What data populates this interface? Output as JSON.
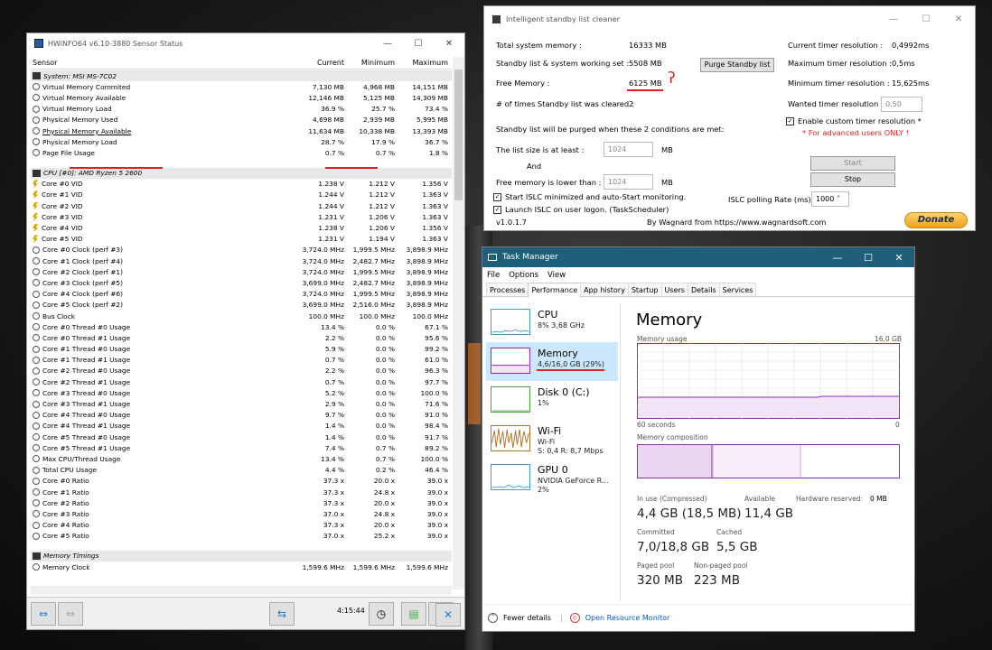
{
  "hwinfo": {
    "title": "HWiNFO64 v6.10-3880 Sensor Status",
    "columns": [
      "Sensor",
      "Current",
      "Minimum",
      "Maximum"
    ],
    "rows": [
      {
        "t": "grp",
        "n": "System: MSI MS-7C02",
        "i": "pc"
      },
      {
        "n": "Virtual Memory Commited",
        "c": "7,130 MB",
        "mi": "4,968 MB",
        "ma": "14,151 MB",
        "i": "round"
      },
      {
        "n": "Virtual Memory Available",
        "c": "12,146 MB",
        "mi": "5,125 MB",
        "ma": "14,309 MB",
        "i": "round"
      },
      {
        "n": "Virtual Memory Load",
        "c": "36.9 %",
        "mi": "25.7 %",
        "ma": "73.4 %",
        "i": "round"
      },
      {
        "n": "Physical Memory Used",
        "c": "4,698 MB",
        "mi": "2,939 MB",
        "ma": "5,995 MB",
        "i": "round"
      },
      {
        "n": "Physical Memory Available",
        "c": "11,634 MB",
        "mi": "10,338 MB",
        "ma": "13,393 MB",
        "i": "round",
        "hl": true
      },
      {
        "n": "Physical Memory Load",
        "c": "28.7 %",
        "mi": "17.9 %",
        "ma": "36.7 %",
        "i": "round"
      },
      {
        "n": "Page File Usage",
        "c": "0.7 %",
        "mi": "0.7 %",
        "ma": "1.8 %",
        "i": "round"
      },
      {
        "t": "gap"
      },
      {
        "t": "grp",
        "n": "CPU [#0]: AMD Ryzen 5 2600",
        "i": "chip"
      },
      {
        "n": "Core #0 VID",
        "c": "1.238 V",
        "mi": "1.212 V",
        "ma": "1.356 V",
        "i": "volt"
      },
      {
        "n": "Core #1 VID",
        "c": "1.244 V",
        "mi": "1.212 V",
        "ma": "1.363 V",
        "i": "volt"
      },
      {
        "n": "Core #2 VID",
        "c": "1.244 V",
        "mi": "1.212 V",
        "ma": "1.363 V",
        "i": "volt"
      },
      {
        "n": "Core #3 VID",
        "c": "1.231 V",
        "mi": "1.206 V",
        "ma": "1.363 V",
        "i": "volt"
      },
      {
        "n": "Core #4 VID",
        "c": "1.238 V",
        "mi": "1.206 V",
        "ma": "1.356 V",
        "i": "volt"
      },
      {
        "n": "Core #5 VID",
        "c": "1.231 V",
        "mi": "1.194 V",
        "ma": "1.363 V",
        "i": "volt"
      },
      {
        "n": "Core #0 Clock (perf #3)",
        "c": "3,724.0 MHz",
        "mi": "1,999.5 MHz",
        "ma": "3,898.9 MHz",
        "i": "round"
      },
      {
        "n": "Core #1 Clock (perf #4)",
        "c": "3,724.0 MHz",
        "mi": "2,482.7 MHz",
        "ma": "3,898.9 MHz",
        "i": "round"
      },
      {
        "n": "Core #2 Clock (perf #1)",
        "c": "3,724.0 MHz",
        "mi": "1,999.5 MHz",
        "ma": "3,898.9 MHz",
        "i": "round"
      },
      {
        "n": "Core #3 Clock (perf #5)",
        "c": "3,699.0 MHz",
        "mi": "2,482.7 MHz",
        "ma": "3,898.9 MHz",
        "i": "round"
      },
      {
        "n": "Core #4 Clock (perf #6)",
        "c": "3,724.0 MHz",
        "mi": "1,999.5 MHz",
        "ma": "3,898.9 MHz",
        "i": "round"
      },
      {
        "n": "Core #5 Clock (perf #2)",
        "c": "3,699.0 MHz",
        "mi": "2,516.0 MHz",
        "ma": "3,898.9 MHz",
        "i": "round"
      },
      {
        "n": "Bus Clock",
        "c": "100.0 MHz",
        "mi": "100.0 MHz",
        "ma": "100.0 MHz",
        "i": "round"
      },
      {
        "n": "Core #0 Thread #0 Usage",
        "c": "13.4 %",
        "mi": "0.0 %",
        "ma": "67.1 %",
        "i": "round"
      },
      {
        "n": "Core #0 Thread #1 Usage",
        "c": "2.2 %",
        "mi": "0.0 %",
        "ma": "95.6 %",
        "i": "round"
      },
      {
        "n": "Core #1 Thread #0 Usage",
        "c": "5.9 %",
        "mi": "0.0 %",
        "ma": "99.2 %",
        "i": "round"
      },
      {
        "n": "Core #1 Thread #1 Usage",
        "c": "0.7 %",
        "mi": "0.0 %",
        "ma": "61.0 %",
        "i": "round"
      },
      {
        "n": "Core #2 Thread #0 Usage",
        "c": "2.2 %",
        "mi": "0.0 %",
        "ma": "96.3 %",
        "i": "round"
      },
      {
        "n": "Core #2 Thread #1 Usage",
        "c": "0.7 %",
        "mi": "0.0 %",
        "ma": "97.7 %",
        "i": "round"
      },
      {
        "n": "Core #3 Thread #0 Usage",
        "c": "5.2 %",
        "mi": "0.0 %",
        "ma": "100.0 %",
        "i": "round"
      },
      {
        "n": "Core #3 Thread #1 Usage",
        "c": "2.9 %",
        "mi": "0.0 %",
        "ma": "71.6 %",
        "i": "round"
      },
      {
        "n": "Core #4 Thread #0 Usage",
        "c": "9.7 %",
        "mi": "0.0 %",
        "ma": "91.0 %",
        "i": "round"
      },
      {
        "n": "Core #4 Thread #1 Usage",
        "c": "1.4 %",
        "mi": "0.0 %",
        "ma": "98.4 %",
        "i": "round"
      },
      {
        "n": "Core #5 Thread #0 Usage",
        "c": "1.4 %",
        "mi": "0.0 %",
        "ma": "91.7 %",
        "i": "round"
      },
      {
        "n": "Core #5 Thread #1 Usage",
        "c": "7.4 %",
        "mi": "0.7 %",
        "ma": "89.2 %",
        "i": "round"
      },
      {
        "n": "Max CPU/Thread Usage",
        "c": "13.4 %",
        "mi": "0.7 %",
        "ma": "100.0 %",
        "i": "round"
      },
      {
        "n": "Total CPU Usage",
        "c": "4.4 %",
        "mi": "0.2 %",
        "ma": "46.4 %",
        "i": "round"
      },
      {
        "n": "Core #0 Ratio",
        "c": "37.3 x",
        "mi": "20.0 x",
        "ma": "39.0 x",
        "i": "round"
      },
      {
        "n": "Core #1 Ratio",
        "c": "37.3 x",
        "mi": "24.8 x",
        "ma": "39.0 x",
        "i": "round"
      },
      {
        "n": "Core #2 Ratio",
        "c": "37.3 x",
        "mi": "20.0 x",
        "ma": "39.0 x",
        "i": "round"
      },
      {
        "n": "Core #3 Ratio",
        "c": "37.0 x",
        "mi": "24.8 x",
        "ma": "39.0 x",
        "i": "round"
      },
      {
        "n": "Core #4 Ratio",
        "c": "37.3 x",
        "mi": "20.0 x",
        "ma": "39.0 x",
        "i": "round"
      },
      {
        "n": "Core #5 Ratio",
        "c": "37.0 x",
        "mi": "25.2 x",
        "ma": "39.0 x",
        "i": "round"
      },
      {
        "t": "gap"
      },
      {
        "t": "grp",
        "n": "Memory Timings",
        "i": "chip"
      },
      {
        "n": "Memory Clock",
        "c": "1,599.6 MHz",
        "mi": "1,599.6 MHz",
        "ma": "1,599.6 MHz",
        "i": "round"
      }
    ],
    "footer_time": "4:15:44"
  },
  "islc": {
    "title": "Intelligent standby list cleaner",
    "total_label": "Total system memory :",
    "total_value": "16333 MB",
    "standby_label": "Standby list & system working set :",
    "standby_value": "5508 MB",
    "free_label": "Free Memory :",
    "free_value": "6125 MB",
    "cleared_label": "# of times Standby list was cleared :",
    "cleared_value": "2",
    "purge_button": "Purge Standby list",
    "cur_timer_label": "Current timer resolution :",
    "cur_timer_value": "0,4992ms",
    "max_timer_label": "Maximum timer resolution :",
    "max_timer_value": "0,5ms",
    "min_timer_label": "Minimum timer resolution :",
    "min_timer_value": "15,625ms",
    "wanted_label": "Wanted timer resolution :",
    "wanted_value": "0.50",
    "custom_label": "Enable custom timer resolution *",
    "advanced_note": "* For advanced users ONLY !",
    "conditions_text": "Standby list will be purged when these 2 conditions are met:",
    "list_size_label": "The list size is at least :",
    "list_size_value": "1024",
    "mb1": "MB",
    "and_text": "And",
    "free_lower_label": "Free memory is lower than :",
    "free_lower_value": "1024",
    "mb2": "MB",
    "start_min_label": "Start ISLC minimized and auto-Start monitoring.",
    "launch_label": "Launch ISLC on user logon. (TaskScheduler)",
    "polling_label": "ISLC polling Rate (ms):",
    "polling_value": "1000",
    "start_button": "Start",
    "stop_button": "Stop",
    "version": "v1.0.1.7",
    "credit": "By Wagnard from https://www.wagnardsoft.com",
    "donate": "Donate",
    "accent": "#e02020"
  },
  "taskmgr": {
    "title": "Task Manager",
    "menu": [
      "File",
      "Options",
      "View"
    ],
    "tabs": [
      "Processes",
      "Performance",
      "App history",
      "Startup",
      "Users",
      "Details",
      "Services"
    ],
    "side": [
      {
        "name": "CPU",
        "sub": "8% 3,68 GHz",
        "sub2": ""
      },
      {
        "name": "Memory",
        "sub": "4,6/16,0 GB (29%)",
        "sub2": ""
      },
      {
        "name": "Disk 0 (C:)",
        "sub": "1%",
        "sub2": ""
      },
      {
        "name": "Wi-Fi",
        "sub": "Wi-Fi",
        "sub2": "S: 0,4 R: 8,7 Mbps"
      },
      {
        "name": "GPU 0",
        "sub": "NVIDIA GeForce R...",
        "sub2": "2%"
      }
    ],
    "heading": "Memory",
    "usage_label": "Memory usage",
    "usage_max": "16,0 GB",
    "seconds_label": "60 seconds",
    "zero_label": "0",
    "composition_label": "Memory composition",
    "inuse_label": "In use (Compressed)",
    "inuse_value": "4,4 GB (18,5 MB)",
    "avail_label": "Available",
    "avail_value": "11,4 GB",
    "hwres_label": "Hardware reserved:",
    "hwres_value": "0 MB",
    "committed_label": "Committed",
    "committed_value": "7,0/18,8 GB",
    "cached_label": "Cached",
    "cached_value": "5,5 GB",
    "paged_label": "Paged pool",
    "paged_value": "320 MB",
    "nonpaged_label": "Non-paged pool",
    "nonpaged_value": "223 MB",
    "fewer": "Fewer details",
    "resmon": "Open Resource Monitor",
    "accent": "#8b2fa8"
  }
}
